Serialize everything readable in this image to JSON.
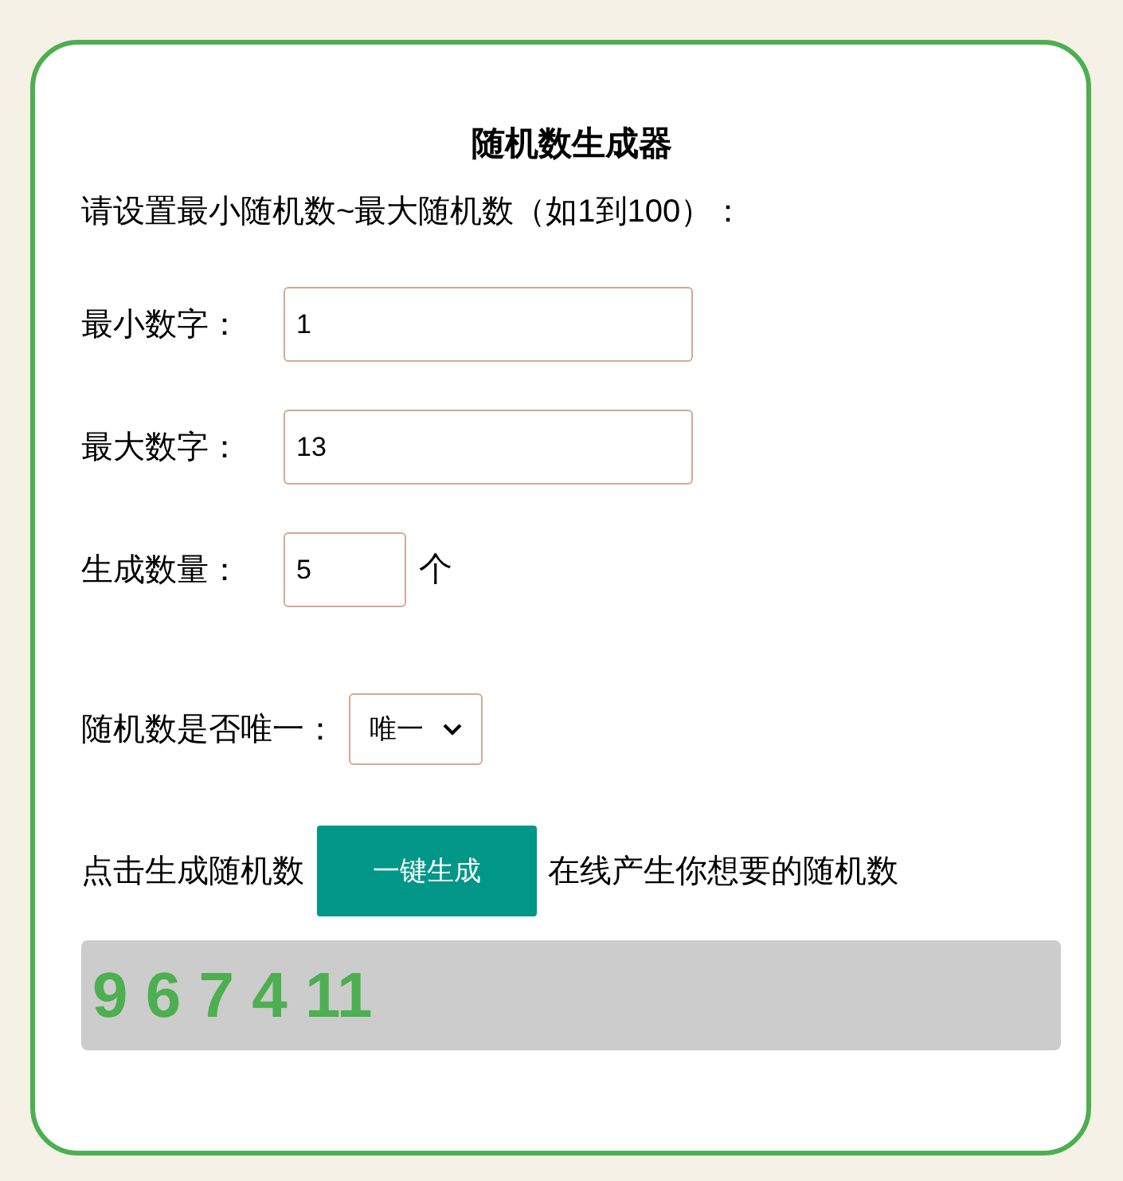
{
  "title": "随机数生成器",
  "instruction": "请设置最小随机数~最大随机数（如1到100）：",
  "fields": [
    {
      "label": "最小数字：",
      "value": "1",
      "kind": "wide"
    },
    {
      "label": "最大数字：",
      "value": "13",
      "kind": "wide"
    },
    {
      "label": "生成数量：",
      "value": "5",
      "kind": "narrow",
      "suffix": "个"
    }
  ],
  "unique": {
    "label": "随机数是否唯一：",
    "value": "唯一"
  },
  "generate": {
    "before": "点击生成随机数",
    "button": "一键生成",
    "after": "在线产生你想要的随机数"
  },
  "result": "9 6 7 4 11"
}
